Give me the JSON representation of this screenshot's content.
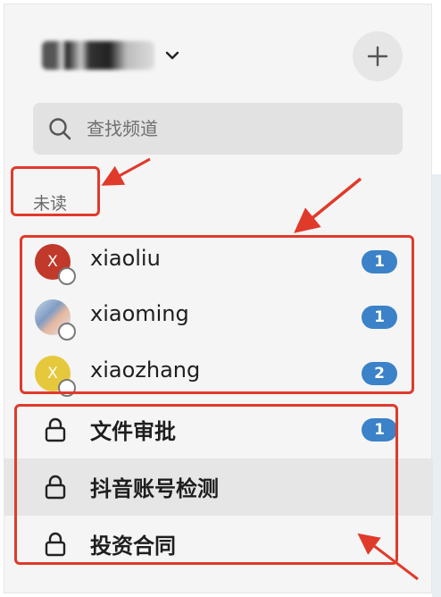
{
  "header": {
    "workspace_name": "",
    "add_icon": "plus-icon",
    "chevron_icon": "chevron-down-icon"
  },
  "search": {
    "placeholder": "查找频道",
    "value": ""
  },
  "unread_section": {
    "title": "未读"
  },
  "direct_messages": [
    {
      "name": "xiaoliu",
      "avatar_letter": "X",
      "avatar_color": "#c0392b",
      "badge": "1"
    },
    {
      "name": "xiaoming",
      "avatar_letter": "",
      "avatar_color": "#9fb6d6",
      "badge": "1"
    },
    {
      "name": "xiaozhang",
      "avatar_letter": "X",
      "avatar_color": "#e6c83c",
      "badge": "2"
    }
  ],
  "channels": [
    {
      "name": "文件审批",
      "badge": "1",
      "icon": "lock-icon"
    },
    {
      "name": "抖音账号检测",
      "badge": "",
      "icon": "lock-icon",
      "selected": true
    },
    {
      "name": "投资合同",
      "badge": "",
      "icon": "lock-icon"
    }
  ],
  "colors": {
    "badge": "#3b82c8",
    "annotation": "#e03a2b",
    "sidebar_bg": "#f5f5f5",
    "selected_row": "#e6e6e6"
  }
}
